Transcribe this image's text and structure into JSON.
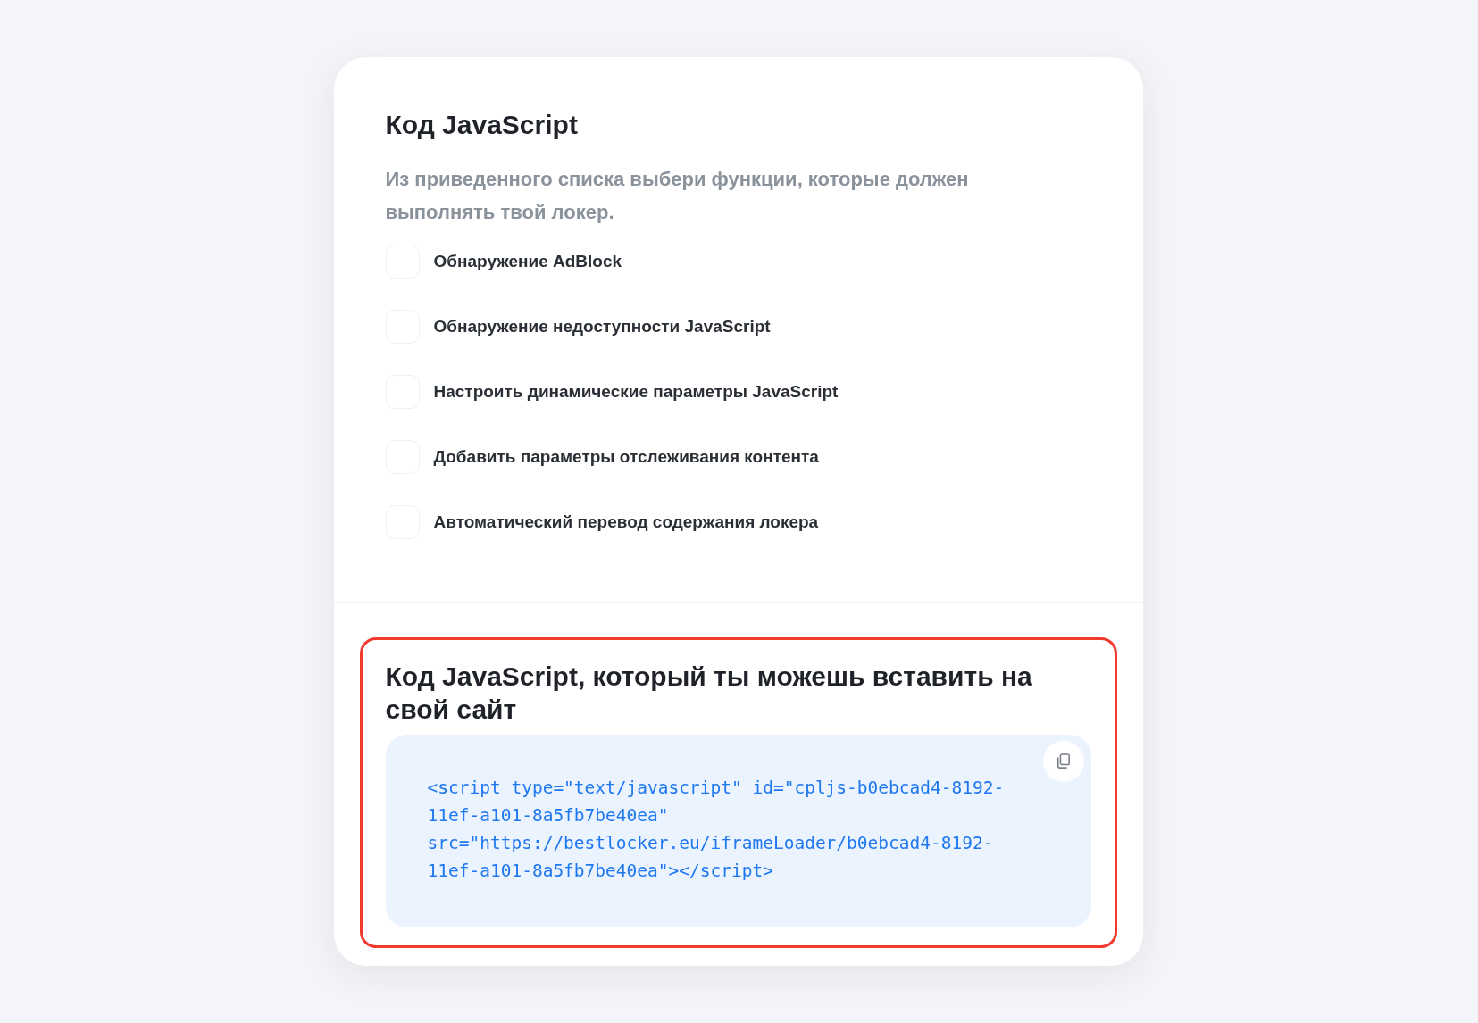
{
  "title": "Код JavaScript",
  "description": "Из приведенного списка выбери функции, которые должен выполнять твой локер.",
  "options": [
    {
      "label": "Обнаружение AdBlock",
      "checked": false
    },
    {
      "label": "Обнаружение недоступности JavaScript",
      "checked": false
    },
    {
      "label": "Настроить динамические параметры JavaScript",
      "checked": false
    },
    {
      "label": "Добавить параметры отслеживания контента",
      "checked": false
    },
    {
      "label": "Автоматический перевод содержания локера",
      "checked": false
    }
  ],
  "code_section": {
    "title": "Код JavaScript, который ты можешь вставить на свой сайт",
    "highlighted": true,
    "code": "<script type=\"text/javascript\" id=\"cpljs-b0ebcad4-8192-11ef-a101-8a5fb7be40ea\" src=\"https://bestlocker.eu/iframeLoader/b0ebcad4-8192-11ef-a101-8a5fb7be40ea\"></script>"
  }
}
